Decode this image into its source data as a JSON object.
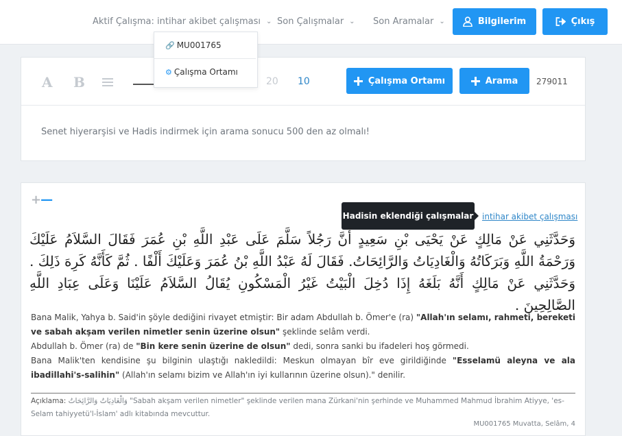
{
  "topbar": {
    "active_study": "Aktif Çalışma: intihar akibet çalışması",
    "recent_studies": "Son Çalışmalar",
    "recent_searches": "Son Aramalar",
    "profile_button": "Bilgilerim",
    "logout_button": "Çıkış"
  },
  "dropdown": {
    "items": [
      {
        "label": "MU001765",
        "icon": "link-icon"
      },
      {
        "label": "Çalışma Ortamı",
        "icon": "gears-icon"
      }
    ]
  },
  "toolbar": {
    "font_a": "A",
    "font_b": "B",
    "sizes": [
      "20",
      "10"
    ],
    "active_size": "10",
    "workspace_button": "Çalışma Ortamı",
    "search_button": "Arama",
    "result_count": "279011"
  },
  "warning": "Senet hiyerarşisi ve Hadis indirmek için arama sonucu 500 den az olmalı!",
  "hadith": {
    "tooltip": "Hadisin eklendiği çalışmalar",
    "study_link": "intihar akibet çalışması",
    "arabic": "وَحَدَّثَنِي عَنْ مَالِكٍ عَنْ يَحْيَى بْنِ سَعِيدٍ أَنَّ رَجُلاً سَلَّمَ عَلَى عَبْدِ اللَّهِ بْنِ عُمَرَ فَقَالَ السَّلاَمُ عَلَيْكَ وَرَحْمَةُ اللَّهِ وَبَرَكَاتُهُ وَالْغَادِيَاتُ وَالرَّائِحَاتُ. فَقَالَ لَهُ عَبْدُ اللَّهِ بْنُ عُمَرَ وَعَلَيْكَ أَلْفًا . ثُمَّ كَأَنَّهُ كَرِهَ ذَلِكَ . وَحَدَّثَنِي عَنْ مَالِكٍ أَنَّهُ بَلَغَهُ إِذَا دُخِلَ الْبَيْتُ غَيْرُ الْمَسْكُونِ يُقَالُ السَّلاَمُ عَلَيْنَا وَعَلَى عِبَادِ اللَّهِ الصَّالِحِينَ .",
    "p1_a": "Bana Malik, Yahya b. Said'in şöyle dediğini rivayet etmiştir: Bir adam Abdullah b. Ömer'e (ra) ",
    "p1_b": "\"Allah'ın selamı, rahmeti, bereketi ve sabah akşam verilen nimetler senin üzerine olsun\"",
    "p1_c": " şeklinde selâm verdi.",
    "p2_a": "Abdullah b. Ömer (ra) de ",
    "p2_b": "\"Bin kere senin üzerine de olsun\"",
    "p2_c": " dedi, sonra sanki bu ifadeleri hoş görmedi.",
    "p3_a": "Bana Malik'ten kendisine şu bilginin ulaştığı nakledildi: Meskun olmayan bîr eve girildiğinde ",
    "p3_b": "\"Esselamü aleyna ve ala ibadillahi's-salihin\"",
    "p3_c": " (Allah'ın selamı bizim ve Allah'ın iyi kullarının üzerine olsun).\" denilir.",
    "explanation_label": "Açıklama:",
    "explanation_arabic": "وَالْغَادِيَاتُ وَالرَّائِحَاتُ",
    "explanation_text": " \"Sabah akşam verilen nimetler\" şeklinde verilen mana Zürkani'nin şerhinde ve Muhammed Mahmud İbrahim Atiyye, 'es-Selam tahiyyetü'l-İslam' adlı kitabında mevcuttur.",
    "footnote": "MU001765 Muvatta, Selâm, 4"
  },
  "colors": {
    "accent": "#2196f3",
    "link": "#2e86c8",
    "tooltip_bg": "#1f2328",
    "page_bg": "#eef1f4"
  }
}
